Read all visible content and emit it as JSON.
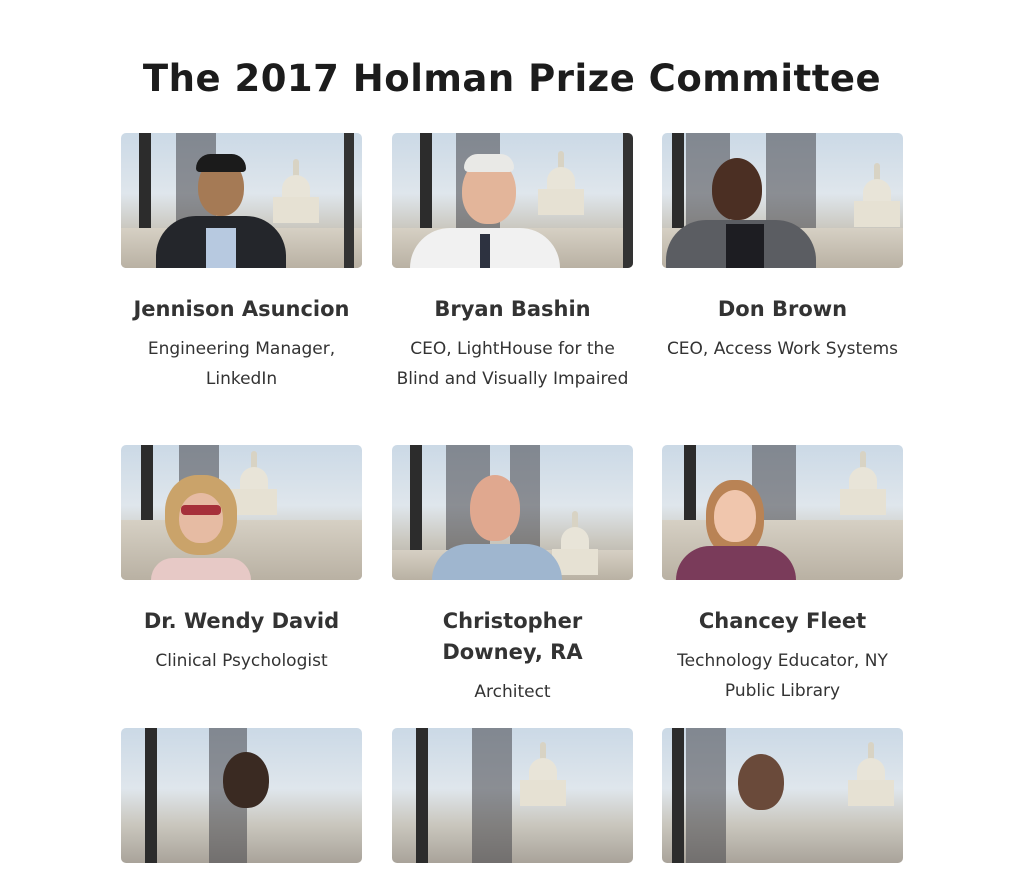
{
  "page": {
    "title": "The 2017 Holman Prize Committee"
  },
  "members": [
    {
      "name": "Jennison Asuncion",
      "role": "Engineering Manager, LinkedIn",
      "photo_alt": "photo-of-jennison-asuncion"
    },
    {
      "name": "Bryan Bashin",
      "role": "CEO, LightHouse for the Blind and Visually Impaired",
      "photo_alt": "photo-of-bryan-bashin"
    },
    {
      "name": "Don Brown",
      "role": "CEO, Access Work Systems",
      "photo_alt": "photo-of-don-brown"
    },
    {
      "name": "Dr. Wendy David",
      "role": "Clinical Psychologist",
      "photo_alt": "photo-of-wendy-david"
    },
    {
      "name": "Christopher Downey, RA",
      "role": "Architect",
      "photo_alt": "photo-of-christopher-downey"
    },
    {
      "name": "Chancey Fleet",
      "role": "Technology Educator, NY Public Library",
      "photo_alt": "photo-of-chancey-fleet"
    },
    {
      "name": "",
      "role": "",
      "photo_alt": "photo-of-committee-member-7"
    },
    {
      "name": "",
      "role": "",
      "photo_alt": "photo-of-committee-member-8"
    },
    {
      "name": "",
      "role": "",
      "photo_alt": "photo-of-committee-member-9"
    }
  ],
  "colors": {
    "title_text": "#1c1c1c",
    "body_text": "#333333",
    "background": "#ffffff"
  }
}
